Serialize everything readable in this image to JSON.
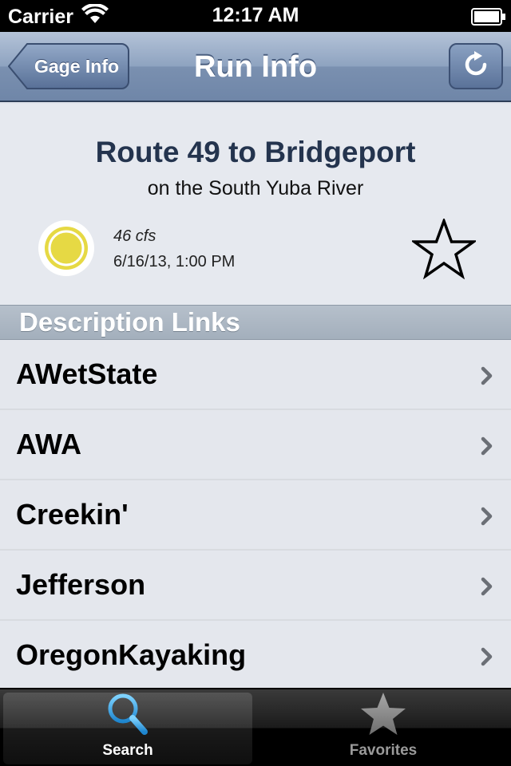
{
  "status_bar": {
    "carrier": "Carrier",
    "time": "12:17 AM"
  },
  "nav": {
    "back_label": "Gage Info",
    "title": "Run Info",
    "refresh_icon": "refresh-icon"
  },
  "run": {
    "title": "Route 49 to Bridgeport",
    "subtitle": "on the South Yuba River",
    "flow": "46 cfs",
    "timestamp": "6/16/13, 1:00 PM",
    "flow_status_color": "#e6d944",
    "favorite_icon": "star-outline-icon"
  },
  "section": {
    "title": "Description Links"
  },
  "links": [
    {
      "label": "AWetState"
    },
    {
      "label": "AWA"
    },
    {
      "label": "Creekin'"
    },
    {
      "label": "Jefferson"
    },
    {
      "label": "OregonKayaking"
    }
  ],
  "tabs": [
    {
      "label": "Search",
      "icon": "search-icon",
      "active": true
    },
    {
      "label": "Favorites",
      "icon": "star-icon",
      "active": false
    }
  ],
  "colors": {
    "nav_tint": "#6f86a8",
    "accent_blue": "#2fa6e6"
  }
}
